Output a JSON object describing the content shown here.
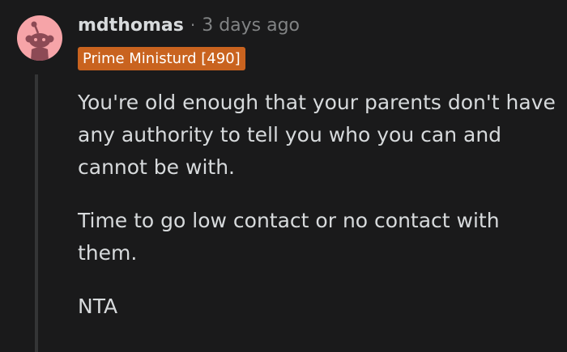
{
  "comment": {
    "author": "mdthomas",
    "separator": "·",
    "timestamp": "3 days ago",
    "flair": "Prime Ministurd [490]",
    "paragraphs": [
      "You're old enough that your parents don't have any authority to tell you who you can and cannot be with.",
      "Time to go low contact or no contact with them.",
      "NTA"
    ],
    "avatar_icon": "reddit-snoo-icon"
  },
  "colors": {
    "background": "#1a1a1b",
    "text": "#d7dadc",
    "muted": "#818384",
    "flair_bg": "#c9631f",
    "avatar_bg": "#f6a4a8",
    "thread_line": "#343536"
  }
}
